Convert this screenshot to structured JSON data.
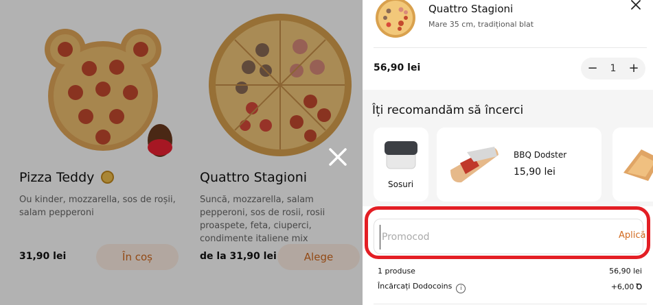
{
  "catalog": {
    "products": [
      {
        "title": "Pizza Teddy",
        "description": "Ou kinder, mozzarella, sos de roșii, salam pepperoni",
        "price": "31,90 lei",
        "button": "În coș"
      },
      {
        "title": "Quattro Stagioni",
        "description": "Suncă, mozzarella, salam pepperoni, sos de rosii, rosii proaspete, feta, ciuperci, condimente italiene mix",
        "price": "de la 31,90 lei",
        "button": "Alege"
      }
    ]
  },
  "cart": {
    "item": {
      "name": "Quattro Stagioni",
      "meta": "Mare 35 cm, tradițional blat",
      "price": "56,90 lei",
      "quantity": "1",
      "minus": "−",
      "plus": "+"
    },
    "recommend": {
      "title": "Îți recomandăm să încerci",
      "items": [
        {
          "label": "Sosuri"
        },
        {
          "label": "BBQ Dodster",
          "price": "15,90 lei"
        }
      ]
    },
    "promo": {
      "placeholder": "Promocod",
      "apply": "Aplică"
    },
    "summary": {
      "products_label": "1 produse",
      "products_value": "56,90 lei",
      "coins_label": "Încărcați Dodocoins",
      "coins_value": "+6,00",
      "coin_symbol": "Ꝺ"
    }
  },
  "colors": {
    "accent": "#d2691e",
    "highlight": "#e31e24",
    "recommend_bg": "#f5f5f5"
  },
  "icons": [
    "close-icon",
    "overlay-close-icon",
    "info-icon",
    "dodocoin-icon",
    "minus-icon",
    "plus-icon"
  ]
}
